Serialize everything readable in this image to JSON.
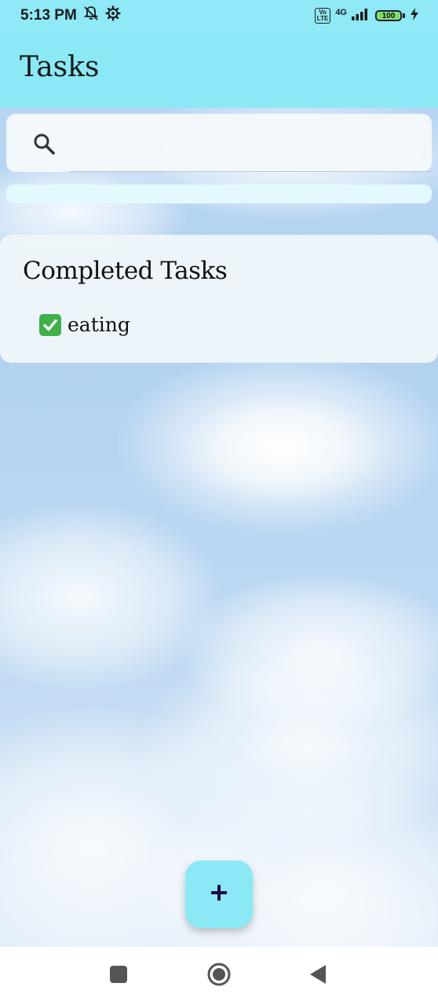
{
  "status_bar": {
    "time": "5:13 PM",
    "network_label": "4G",
    "volte_label": "Vo\nLTE",
    "battery_level": "100",
    "battery_color": "#7ee04f"
  },
  "app_bar": {
    "title": "Tasks",
    "background_color": "#8be9f6"
  },
  "search": {
    "value": "",
    "placeholder": "",
    "icon": "search-icon"
  },
  "progress": {
    "value_fraction": 1.0
  },
  "completed_section": {
    "title": "Completed Tasks",
    "items": [
      {
        "label": "eating",
        "status_icon": "check-box-icon",
        "completed": true
      }
    ]
  },
  "fab": {
    "icon": "plus-icon",
    "background_color": "#8be9f6",
    "icon_color": "#1a0a4a"
  },
  "nav_bar": {
    "buttons": [
      "recents-icon",
      "home-icon",
      "back-icon"
    ]
  }
}
